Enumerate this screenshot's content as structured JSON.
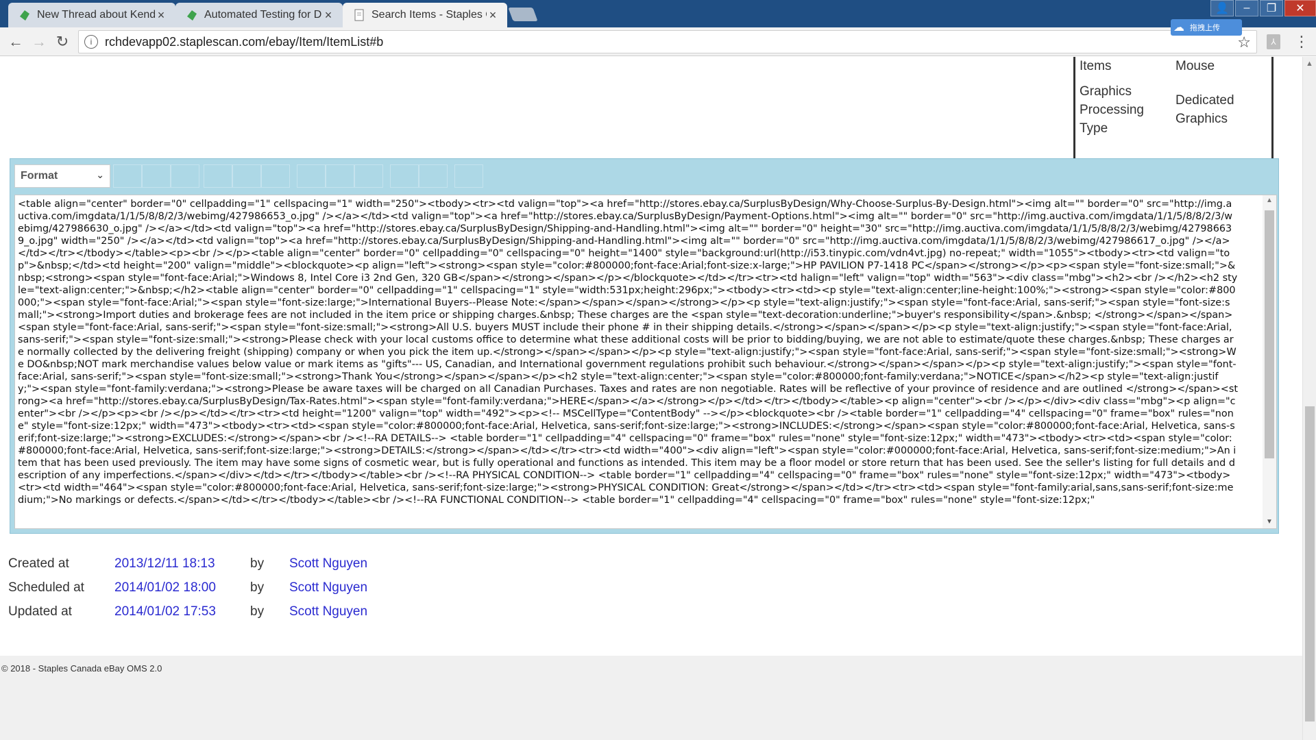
{
  "browser": {
    "tabs": [
      {
        "title": "New Thread about Kendo",
        "active": false
      },
      {
        "title": "Automated Testing for D",
        "active": false
      },
      {
        "title": "Search Items - Staples Ca",
        "active": true
      }
    ],
    "address": "rchdevapp02.staplescan.com/ebay/Item/ItemList#b",
    "extension_label": "拖拽上传"
  },
  "spec": {
    "rows": [
      {
        "key": "Items",
        "value": "Mouse"
      },
      {
        "key": "Graphics Processing Type",
        "value": "Dedicated Graphics"
      }
    ]
  },
  "editor": {
    "format_label": "Format",
    "source_html": "<table align=\"center\" border=\"0\" cellpadding=\"1\" cellspacing=\"1\" width=\"250\"><tbody><tr><td valign=\"top\"><a href=\"http://stores.ebay.ca/SurplusByDesign/Why-Choose-Surplus-By-Design.html\"><img alt=\"\" border=\"0\" src=\"http://img.auctiva.com/imgdata/1/1/5/8/8/2/3/webimg/427986653_o.jpg\" /></a></td><td valign=\"top\"><a href=\"http://stores.ebay.ca/SurplusByDesign/Payment-Options.html\"><img alt=\"\" border=\"0\" src=\"http://img.auctiva.com/imgdata/1/1/5/8/8/2/3/webimg/427986630_o.jpg\" /></a></td><td valign=\"top\"><a href=\"http://stores.ebay.ca/SurplusByDesign/Shipping-and-Handling.html\"><img alt=\"\" border=\"0\" height=\"30\" src=\"http://img.auctiva.com/imgdata/1/1/5/8/8/2/3/webimg/427986639_o.jpg\" width=\"250\" /></a></td><td valign=\"top\"><a href=\"http://stores.ebay.ca/SurplusByDesign/Shipping-and-Handling.html\"><img alt=\"\" border=\"0\" src=\"http://img.auctiva.com/imgdata/1/1/5/8/8/2/3/webimg/427986617_o.jpg\" /></a></td></tr></tbody></table><p><br /></p><table align=\"center\" border=\"0\" cellpadding=\"0\" cellspacing=\"0\" height=\"1400\" style=\"background:url(http://i53.tinypic.com/vdn4vt.jpg) no-repeat;\" width=\"1055\"><tbody><tr><td valign=\"top\">&nbsp;</td><td height=\"200\" valign=\"middle\"><blockquote><p align=\"left\"><strong><span style=\"color:#800000;font-face:Arial;font-size:x-large;\">HP PAVILION P7-1418 PC</span></strong></p><p><span style=\"font-size:small;\">&nbsp;<strong><span style=\"font-face:Arial;\">Windows 8, Intel Core i3 2nd Gen, 320 GB</span></strong></span></p></blockquote></td></tr><tr><td halign=\"left\" valign=\"top\" width=\"563\"><div class=\"mbg\"><h2><br /></h2><h2 style=\"text-align:center;\">&nbsp;</h2><table align=\"center\" border=\"0\" cellpadding=\"1\" cellspacing=\"1\" style=\"width:531px;height:296px;\"><tbody><tr><td><p style=\"text-align:center;line-height:100%;\"><strong><span style=\"color:#800000;\"><span style=\"font-face:Arial;\"><span style=\"font-size:large;\">International Buyers--Please Note:</span></span></span></strong></p><p style=\"text-align:justify;\"><span style=\"font-face:Arial, sans-serif;\"><span style=\"font-size:small;\"><strong>Import duties and brokerage fees are not included in the item price or shipping charges.&nbsp; These charges are the <span style=\"text-decoration:underline;\">buyer's responsibility</span>.&nbsp; </strong></span></span><span style=\"font-face:Arial, sans-serif;\"><span style=\"font-size:small;\"><strong>All U.S. buyers MUST include their phone # in their shipping details.</strong></span></span></p><p style=\"text-align:justify;\"><span style=\"font-face:Arial, sans-serif;\"><span style=\"font-size:small;\"><strong>Please check with your local customs office to determine what these additional costs will be prior to bidding/buying, we are not able to estimate/quote these charges.&nbsp; These charges are normally collected by the delivering freight (shipping) company or when you pick the item up.</strong></span></span></p><p style=\"text-align:justify;\"><span style=\"font-face:Arial, sans-serif;\"><span style=\"font-size:small;\"><strong>We DO&nbsp;NOT mark merchandise values below value or mark items as \"gifts\"--- US, Canadian, and International government regulations prohibit such behaviour.</strong></span></span></p><p style=\"text-align:justify;\"><span style=\"font-face:Arial, sans-serif;\"><span style=\"font-size:small;\"><strong>Thank You</strong></span></span></p><h2 style=\"text-align:center;\"><span style=\"color:#800000;font-family:verdana;\">NOTICE</span></h2><p style=\"text-align:justify;\"><span style=\"font-family:verdana;\"><strong>Please be aware taxes will be charged on all Canadian Purchases. Taxes and rates are non negotiable. Rates will be reflective of your province of residence and are outlined </strong></span><strong><a href=\"http://stores.ebay.ca/SurplusByDesign/Tax-Rates.html\"><span style=\"font-family:verdana;\">HERE</span></a></strong></p></td></tr></tbody></table><p align=\"center\"><br /></p></div><div class=\"mbg\"><p align=\"center\"><br /></p><p><br /></p></td></tr><tr><td height=\"1200\" valign=\"top\" width=\"492\"><p><!-- MSCellType=\"ContentBody\" --></p><blockquote><br /><table border=\"1\" cellpadding=\"4\" cellspacing=\"0\" frame=\"box\" rules=\"none\" style=\"font-size:12px;\" width=\"473\"><tbody><tr><td><span style=\"color:#800000;font-face:Arial, Helvetica, sans-serif;font-size:large;\"><strong>INCLUDES:</strong></span><span style=\"color:#800000;font-face:Arial, Helvetica, sans-serif;font-size:large;\"><strong>EXCLUDES:</strong></span><br /><!--RA DETAILS--> <table border=\"1\" cellpadding=\"4\" cellspacing=\"0\" frame=\"box\" rules=\"none\" style=\"font-size:12px;\" width=\"473\"><tbody><tr><td><span style=\"color:#800000;font-face:Arial, Helvetica, sans-serif;font-size:large;\"><strong>DETAILS:</strong></span></td></tr><tr><td width=\"400\"><div align=\"left\"><span style=\"color:#000000;font-face:Arial, Helvetica, sans-serif;font-size:medium;\">An item that has been used previously. The item may have some signs of cosmetic wear, but is fully operational and functions as intended. This item may be a floor model or store return that has been used. See the seller's listing for full details and description of any imperfections.</span></div></td></tr></tbody></table><br /><!--RA PHYSICAL CONDITION--> <table border=\"1\" cellpadding=\"4\" cellspacing=\"0\" frame=\"box\" rules=\"none\" style=\"font-size:12px;\" width=\"473\"><tbody><tr><td width=\"464\"><span style=\"color:#800000;font-face:Arial, Helvetica, sans-serif;font-size:large;\"><strong>PHYSICAL CONDITION: Great</strong></span></td></tr><tr><td><span style=\"font-family:arial,sans,sans-serif;font-size:medium;\">No markings or defects.</span></td></tr></tbody></table><br /><!--RA FUNCTIONAL CONDITION--> <table border=\"1\" cellpadding=\"4\" cellspacing=\"0\" frame=\"box\" rules=\"none\" style=\"font-size:12px;\""
  },
  "meta": [
    {
      "label": "Created at",
      "date": "2013/12/11 18:13",
      "by": "by",
      "user": "Scott Nguyen"
    },
    {
      "label": "Scheduled at",
      "date": "2014/01/02 18:00",
      "by": "by",
      "user": "Scott Nguyen"
    },
    {
      "label": "Updated at",
      "date": "2014/01/02 17:53",
      "by": "by",
      "user": "Scott Nguyen"
    }
  ],
  "footer": {
    "text": "© 2018 - Staples Canada eBay OMS 2.0"
  },
  "colors": {
    "editor_toolbar": "#add8e6",
    "link": "#2a2ad0",
    "titlebar": "#1f4e83"
  }
}
